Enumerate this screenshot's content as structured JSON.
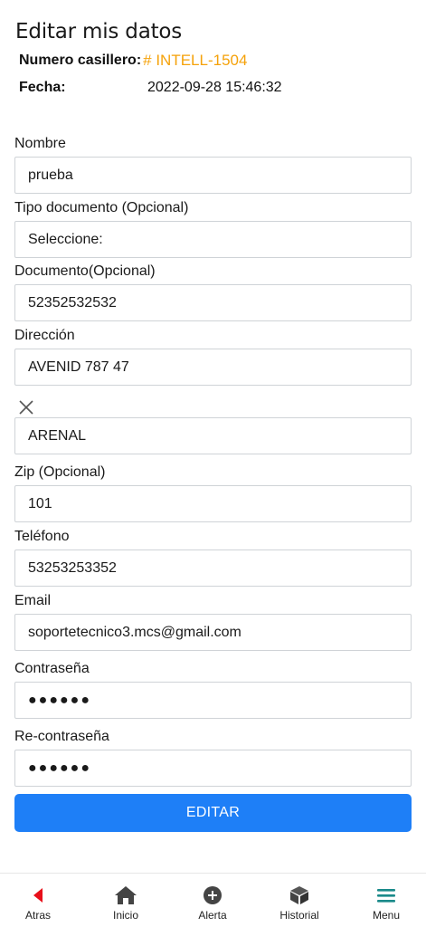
{
  "header": {
    "title": "Editar mis datos",
    "locker_label": "Numero casillero:",
    "locker_value": "# INTELL-1504",
    "date_label": "Fecha:",
    "date_value": "2022-09-28 15:46:32"
  },
  "form": {
    "nombre": {
      "label": "Nombre",
      "value": "prueba"
    },
    "tipo_documento": {
      "label": "Tipo documento (Opcional)",
      "value": "Seleccione:"
    },
    "documento": {
      "label": "Documento(Opcional)",
      "value": "52352532532"
    },
    "direccion": {
      "label": "Dirección",
      "value": "AVENID 787 47"
    },
    "ciudad": {
      "value": "ARENAL"
    },
    "zip": {
      "label": "Zip (Opcional)",
      "value": "101"
    },
    "telefono": {
      "label": "Teléfono",
      "value": "53253253352"
    },
    "email": {
      "label": "Email",
      "value": "soportetecnico3.mcs@gmail.com"
    },
    "contrasena": {
      "label": "Contraseña",
      "value": "●●●●●●"
    },
    "re_contrasena": {
      "label": "Re-contraseña",
      "value": "●●●●●●"
    },
    "submit_label": "EDITAR"
  },
  "colors": {
    "accent_orange": "#f5a20a",
    "button_blue": "#1e7ff7",
    "back_red": "#e8101a",
    "menu_teal": "#1a8a8a"
  },
  "bottom_nav": {
    "items": [
      {
        "label": "Atras",
        "icon": "back-arrow-icon"
      },
      {
        "label": "Inicio",
        "icon": "home-icon"
      },
      {
        "label": "Alerta",
        "icon": "plus-circle-icon"
      },
      {
        "label": "Historial",
        "icon": "box-icon"
      },
      {
        "label": "Menu",
        "icon": "hamburger-icon"
      }
    ]
  }
}
